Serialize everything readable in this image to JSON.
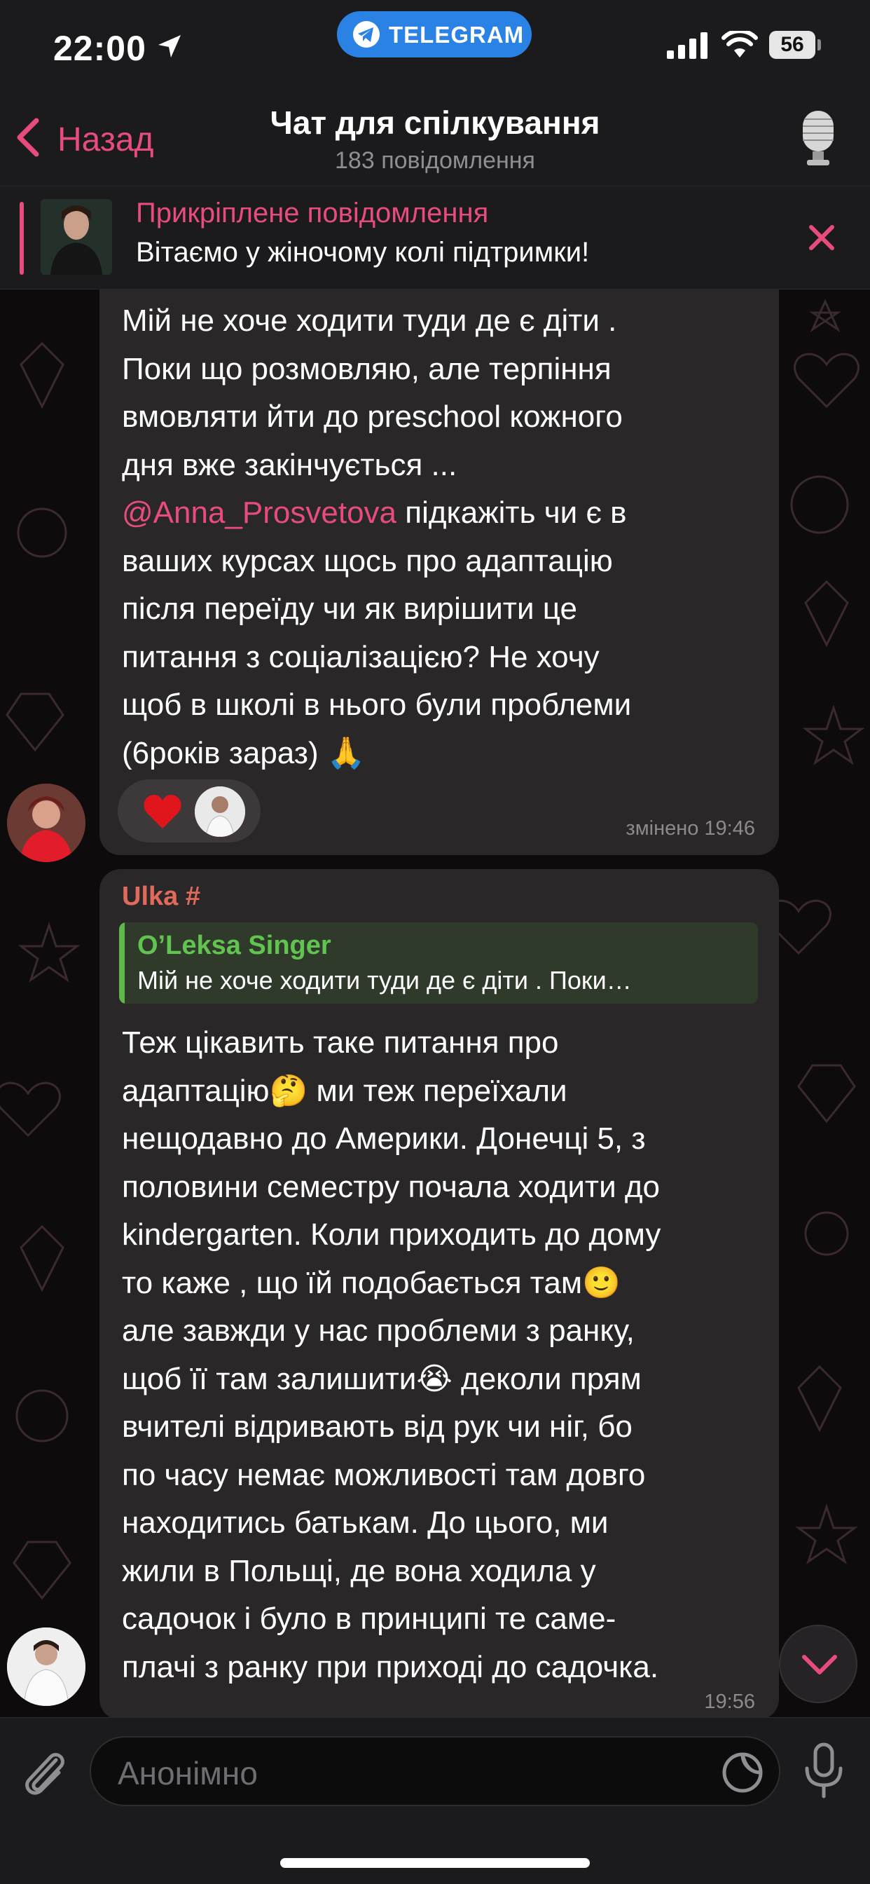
{
  "status_bar": {
    "time": "22:00",
    "app_pill": "TELEGRAM",
    "battery": "56"
  },
  "nav": {
    "back_label": "Назад",
    "title": "Чат для спілкування",
    "subtitle": "183 повідомлення"
  },
  "pinned": {
    "title": "Прикріплене повідомлення",
    "text": "Вітаємо у жіночому колі підтримки!"
  },
  "messages": [
    {
      "lines_before": "Мій не хоче ходити туди де є діти .\nПоки що розмовляю, але терпіння\nвмовляти йти до preschool кожного\nдня вже закінчується ...",
      "mention": "@Anna_Prosvetova",
      "after_mention": " підкажіть чи є в",
      "lines_after": "ваших курсах щось про адаптацію\nпісля переїду чи як вирішити це\nпитання з соціалізацією? Не хочу\nщоб в школі в нього були проблеми\n(6років зараз) 🙏",
      "time": "змінено 19:46",
      "reaction": "heart"
    },
    {
      "sender": "Ulka #",
      "reply_name": "O’Leksa Singer",
      "reply_text": "Мій не хоче ходити туди де є діти . Поки…",
      "text": "Теж цікавить таке питання про\nадаптацію🤔 ми теж переїхали\nнещодавно до Америки. Донечці 5, з\nполовини семестру почала ходити до\nkindergarten. Коли приходить до дому\nто каже , що їй подобається там🙂\nале завжди у нас проблеми з ранку,\nщоб її там залишити😭 деколи прям\nвчителі відривають від рук чи ніг, бо\nпо часу немає можливості там довго\nнаходитись батькам. До цього, ми\nжили в Польщі, де вона ходила у\nсадочок і було в принципі те саме-\nплачі з ранку при приході до садочка.",
      "time": "19:56"
    }
  ],
  "input": {
    "placeholder": "Анонімно"
  },
  "colors": {
    "accent": "#e84c7d",
    "bubble": "#2a2729",
    "reply_green": "#62c450",
    "sender": "#e06a5b",
    "telegram_blue": "#2a82e4"
  },
  "icons": [
    "location-arrow-icon",
    "telegram-plane-icon",
    "signal-icon",
    "wifi-icon",
    "back-chevron-icon",
    "group-avatar-icon",
    "close-icon",
    "heart-icon",
    "chevron-down-icon",
    "paperclip-icon",
    "sticker-icon",
    "microphone-icon"
  ]
}
